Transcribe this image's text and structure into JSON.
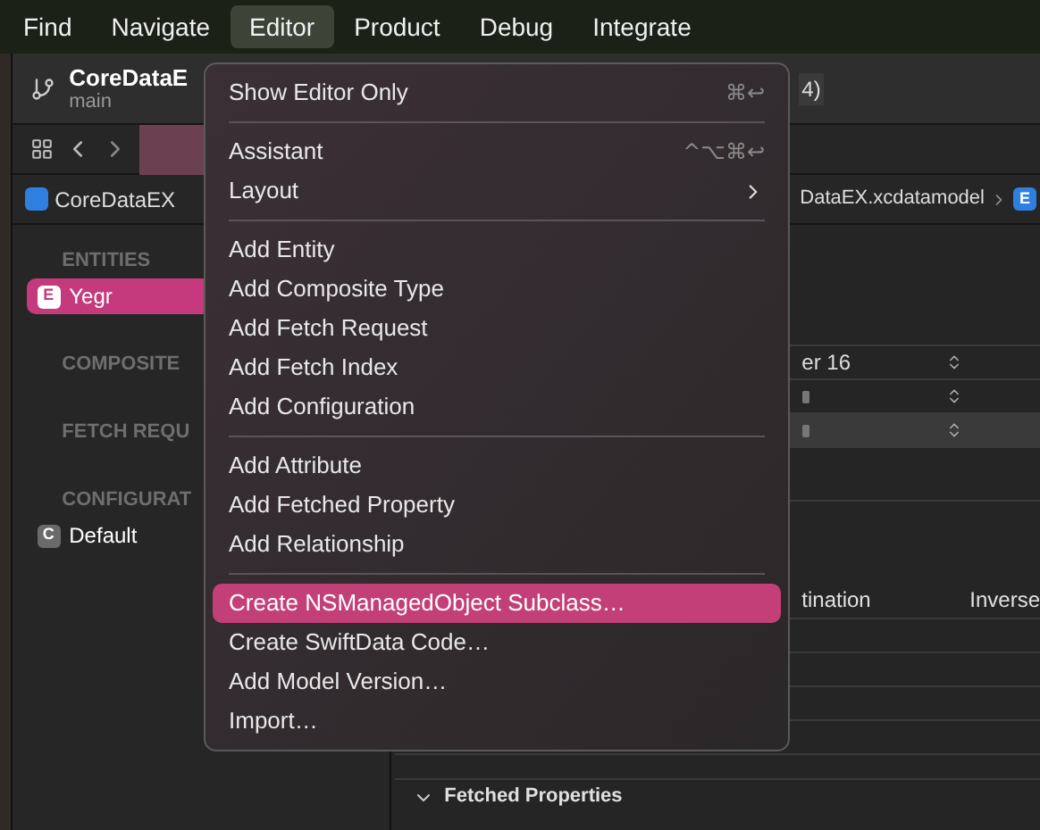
{
  "menu_bar": {
    "items": [
      {
        "label": "Find",
        "selected": false
      },
      {
        "label": "Navigate",
        "selected": false
      },
      {
        "label": "Editor",
        "selected": true
      },
      {
        "label": "Product",
        "selected": false
      },
      {
        "label": "Debug",
        "selected": false
      },
      {
        "label": "Integrate",
        "selected": false
      }
    ]
  },
  "toolbar": {
    "project": "CoreDataE",
    "branch": "main",
    "status": "4)"
  },
  "breadcrumb": {
    "project": "CoreDataEX",
    "file": "DataEX.xcdatamodel",
    "entity_badge": "E"
  },
  "sidebar": {
    "sections": [
      {
        "title": "ENTITIES",
        "items": [
          {
            "badge": "E",
            "label": "Yegr",
            "selected": true
          }
        ]
      },
      {
        "title": "COMPOSITE"
      },
      {
        "title": "FETCH REQU"
      },
      {
        "title": "CONFIGURAT",
        "items": [
          {
            "badge": "C",
            "label": "Default",
            "selected": false
          }
        ]
      }
    ]
  },
  "editor": {
    "popups": [
      {
        "value": "er 16",
        "selected": false
      },
      {
        "selected": false
      },
      {
        "selected": true
      }
    ],
    "columns": [
      "tination",
      "Inverse"
    ],
    "section": {
      "title": "Fetched Properties",
      "expanded": true
    }
  },
  "menu": {
    "groups": [
      [
        {
          "label": "Show Editor Only",
          "shortcut": "⌘↩",
          "submenu": false,
          "selected": false
        }
      ],
      [
        {
          "label": "Assistant",
          "shortcut": "^⌥⌘↩",
          "submenu": false,
          "selected": false
        },
        {
          "label": "Layout",
          "submenu": true,
          "selected": false
        }
      ],
      [
        {
          "label": "Add Entity",
          "submenu": false,
          "selected": false
        },
        {
          "label": "Add Composite Type",
          "submenu": false,
          "selected": false
        },
        {
          "label": "Add Fetch Request",
          "submenu": false,
          "selected": false
        },
        {
          "label": "Add Fetch Index",
          "submenu": false,
          "selected": false
        },
        {
          "label": "Add Configuration",
          "submenu": false,
          "selected": false
        }
      ],
      [
        {
          "label": "Add Attribute",
          "submenu": false,
          "selected": false
        },
        {
          "label": "Add Fetched Property",
          "submenu": false,
          "selected": false
        },
        {
          "label": "Add Relationship",
          "submenu": false,
          "selected": false
        }
      ],
      [
        {
          "label": "Create NSManagedObject Subclass…",
          "submenu": false,
          "selected": true
        },
        {
          "label": "Create SwiftData Code…",
          "submenu": false,
          "selected": false
        },
        {
          "label": "Add Model Version…",
          "submenu": false,
          "selected": false
        },
        {
          "label": "Import…",
          "submenu": false,
          "selected": false
        }
      ]
    ]
  }
}
